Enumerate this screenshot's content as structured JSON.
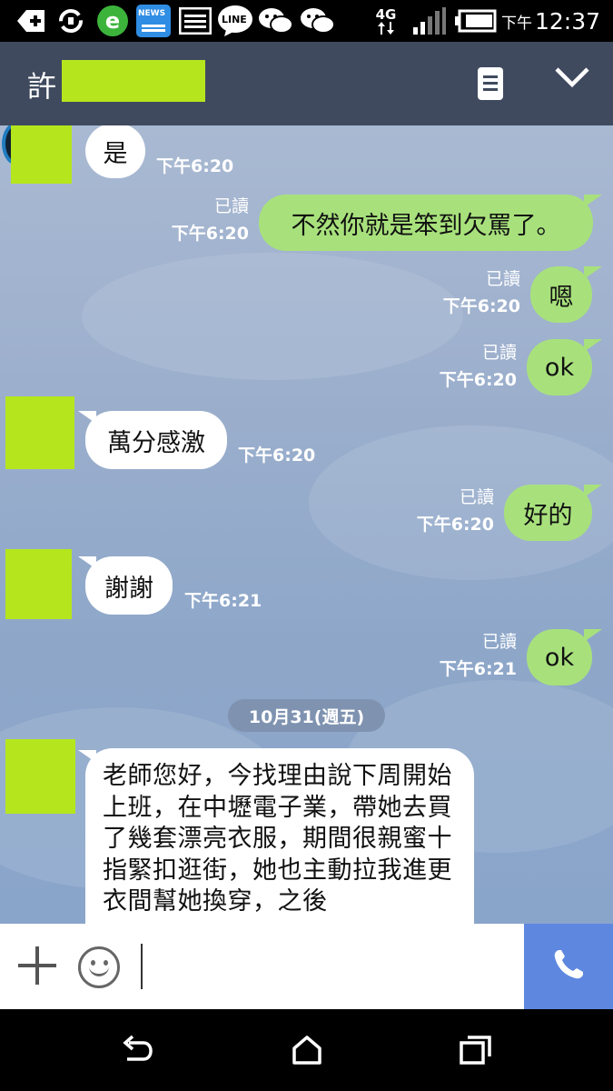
{
  "status_bar": {
    "time_prefix": "下午",
    "time": "12:37",
    "network": "4G",
    "news_label": "NEWS",
    "line_label": "LINE"
  },
  "header": {
    "title": "許"
  },
  "messages": {
    "m1_text": "是",
    "m1_time": "下午6:20",
    "m2_text": "不然你就是笨到欠罵了。",
    "m2_read": "已讀",
    "m2_time": "下午6:20",
    "m3_text": "嗯",
    "m3_read": "已讀",
    "m3_time": "下午6:20",
    "m4_text": "ok",
    "m4_read": "已讀",
    "m4_time": "下午6:20",
    "m5_text": "萬分感激",
    "m5_time": "下午6:20",
    "m6_text": "好的",
    "m6_read": "已讀",
    "m6_time": "下午6:20",
    "m7_text": "謝謝",
    "m7_time": "下午6:21",
    "m8_text": "ok",
    "m8_read": "已讀",
    "m8_time": "下午6:21",
    "date_separator": "10月31(週五)",
    "long_message": "老師您好，今找理由說下周開始上班，在中壢電子業，帶她去買了幾套漂亮衣服，期間很親蜜十指緊扣逛街，她也主動拉我進更衣間幫她換穿，之後"
  },
  "colors": {
    "header_bg": "#3f4a5e",
    "outgoing_bubble": "#a8e17c",
    "incoming_bubble": "#ffffff",
    "redaction": "#b5e61d",
    "call_button": "#5e87e0"
  },
  "icons": [
    "add-icon",
    "sync-icon",
    "browser-icon",
    "news-icon",
    "image-icon",
    "line-icon",
    "wechat-icon",
    "wechat-icon",
    "signal-icon",
    "battery-icon",
    "memo-icon",
    "chevron-down-icon",
    "plus-icon",
    "emoji-icon",
    "phone-icon",
    "back-icon",
    "home-icon",
    "recents-icon"
  ]
}
